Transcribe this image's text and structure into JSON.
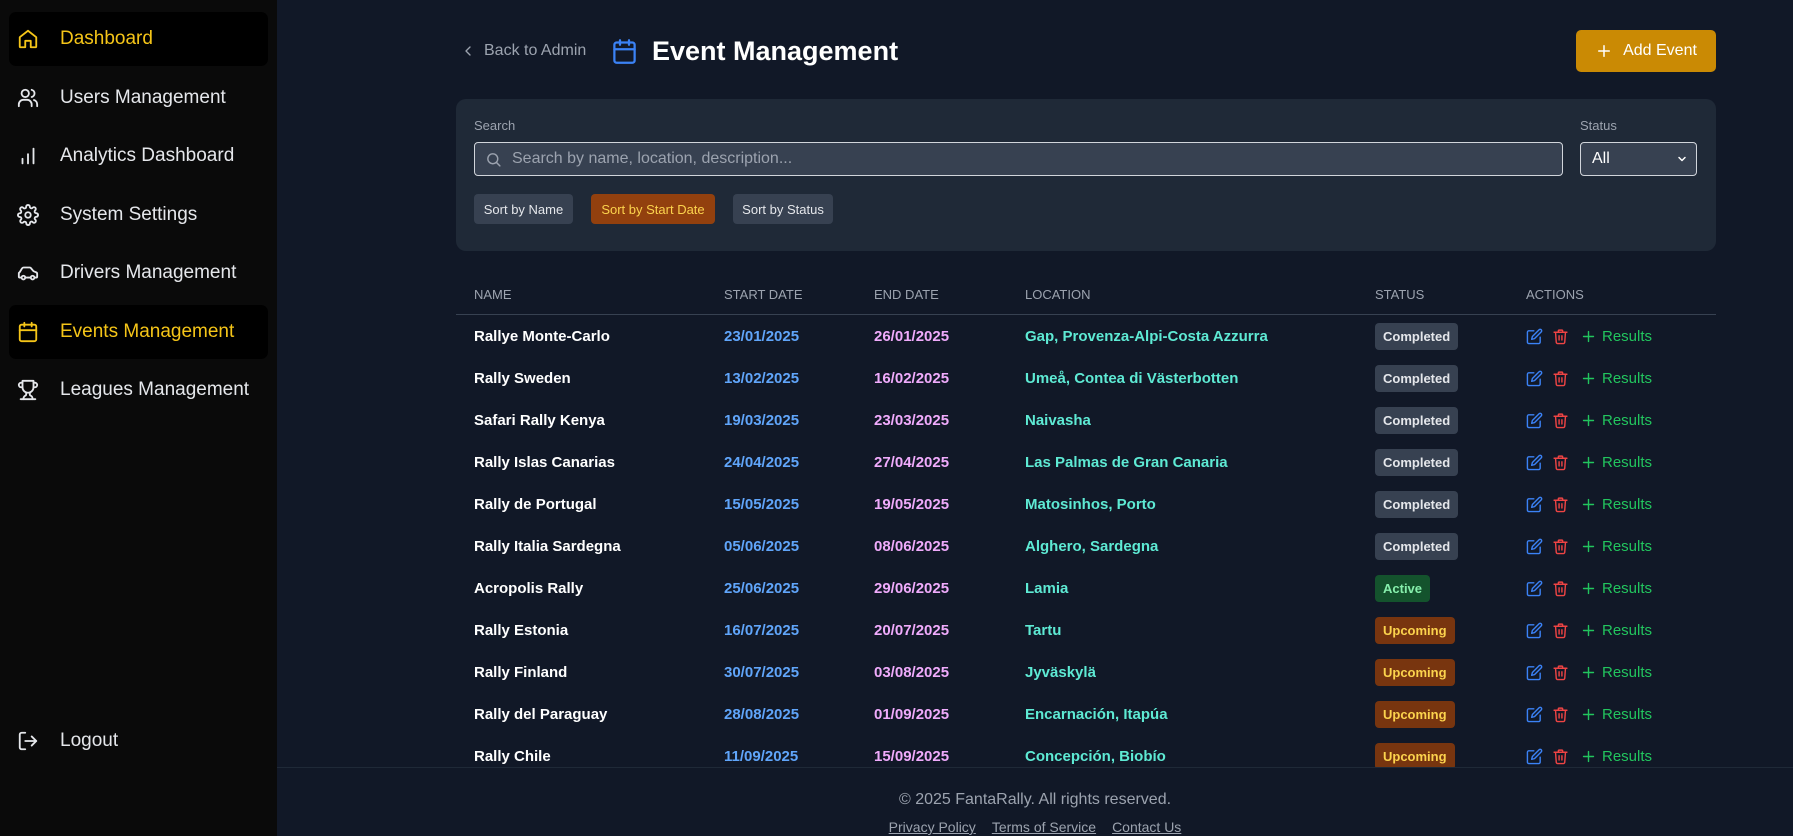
{
  "sidebar": {
    "items": [
      {
        "label": "Dashboard",
        "icon": "home-icon",
        "active": true
      },
      {
        "label": "Users Management",
        "icon": "users-icon",
        "active": false
      },
      {
        "label": "Analytics Dashboard",
        "icon": "bar-chart-icon",
        "active": false
      },
      {
        "label": "System Settings",
        "icon": "gear-icon",
        "active": false
      },
      {
        "label": "Drivers Management",
        "icon": "car-icon",
        "active": false
      },
      {
        "label": "Events Management",
        "icon": "calendar-icon",
        "active": true
      },
      {
        "label": "Leagues Management",
        "icon": "trophy-icon",
        "active": false
      }
    ],
    "logout": "Logout"
  },
  "header": {
    "back": "Back to Admin",
    "title": "Event Management",
    "add_button": "Add Event"
  },
  "filters": {
    "search_label": "Search",
    "search_placeholder": "Search by name, location, description...",
    "status_label": "Status",
    "status_value": "All",
    "sort": [
      "Sort by Name",
      "Sort by Start Date",
      "Sort by Status"
    ],
    "active_sort": "Sort by Start Date"
  },
  "table": {
    "headers": [
      "NAME",
      "START DATE",
      "END DATE",
      "LOCATION",
      "STATUS",
      "ACTIONS"
    ],
    "results_label": "Results",
    "rows": [
      {
        "name": "Rallye Monte-Carlo",
        "start": "23/01/2025",
        "end": "26/01/2025",
        "location": "Gap, Provenza-Alpi-Costa Azzurra",
        "status": "Completed"
      },
      {
        "name": "Rally Sweden",
        "start": "13/02/2025",
        "end": "16/02/2025",
        "location": "Umeå, Contea di Västerbotten",
        "status": "Completed"
      },
      {
        "name": "Safari Rally Kenya",
        "start": "19/03/2025",
        "end": "23/03/2025",
        "location": "Naivasha",
        "status": "Completed"
      },
      {
        "name": "Rally Islas Canarias",
        "start": "24/04/2025",
        "end": "27/04/2025",
        "location": "Las Palmas de Gran Canaria",
        "status": "Completed"
      },
      {
        "name": "Rally de Portugal",
        "start": "15/05/2025",
        "end": "19/05/2025",
        "location": "Matosinhos, Porto",
        "status": "Completed"
      },
      {
        "name": "Rally Italia Sardegna",
        "start": "05/06/2025",
        "end": "08/06/2025",
        "location": "Alghero, Sardegna",
        "status": "Completed"
      },
      {
        "name": "Acropolis Rally",
        "start": "25/06/2025",
        "end": "29/06/2025",
        "location": "Lamia",
        "status": "Active"
      },
      {
        "name": "Rally Estonia",
        "start": "16/07/2025",
        "end": "20/07/2025",
        "location": "Tartu",
        "status": "Upcoming"
      },
      {
        "name": "Rally Finland",
        "start": "30/07/2025",
        "end": "03/08/2025",
        "location": "Jyväskylä",
        "status": "Upcoming"
      },
      {
        "name": "Rally del Paraguay",
        "start": "28/08/2025",
        "end": "01/09/2025",
        "location": "Encarnación, Itapúa",
        "status": "Upcoming"
      },
      {
        "name": "Rally Chile",
        "start": "11/09/2025",
        "end": "15/09/2025",
        "location": "Concepción, Biobío",
        "status": "Upcoming"
      }
    ]
  },
  "footer": {
    "copyright": "© 2025 FantaRally. All rights reserved.",
    "links": [
      "Privacy Policy",
      "Terms of Service",
      "Contact Us"
    ]
  },
  "colors": {
    "accent": "#f5c518",
    "button": "#ca8a04",
    "background": "#111827",
    "sidebar": "#0a0a0a"
  }
}
